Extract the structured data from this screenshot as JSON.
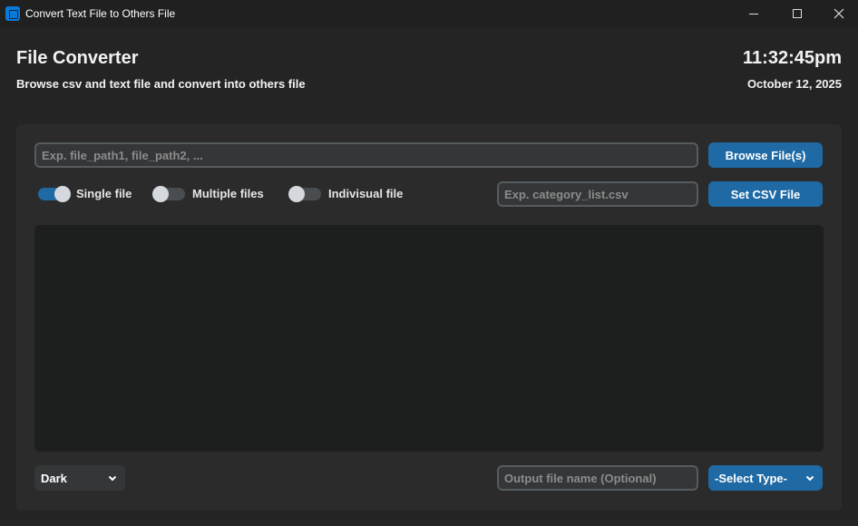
{
  "window": {
    "title": "Convert Text File to Others File"
  },
  "header": {
    "title": "File Converter",
    "subtitle": "Browse csv and text file and convert into others file",
    "time": "11:32:45pm",
    "date": "October 12, 2025"
  },
  "file_input": {
    "placeholder": "Exp. file_path1, file_path2, ...",
    "value": ""
  },
  "browse_button": {
    "label": "Browse File(s)"
  },
  "modes": [
    {
      "label": "Single file",
      "on": true
    },
    {
      "label": "Multiple files",
      "on": false
    },
    {
      "label": "Indivisual file",
      "on": false
    }
  ],
  "csv_input": {
    "placeholder": "Exp. category_list.csv",
    "value": ""
  },
  "set_csv_button": {
    "label": "Set CSV File"
  },
  "theme_select": {
    "value": "Dark"
  },
  "output_input": {
    "placeholder": "Output file name (Optional)",
    "value": ""
  },
  "type_select": {
    "value": "-Select Type-"
  },
  "colors": {
    "accent": "#1f6aa5",
    "background": "#242424",
    "panel": "#2b2b2b",
    "textbox": "#1d1e1e"
  },
  "icons": {
    "app": "app-window-icon",
    "minimize": "minimize-icon",
    "maximize": "maximize-icon",
    "close": "close-icon",
    "dropdown": "chevron-down-icon"
  }
}
